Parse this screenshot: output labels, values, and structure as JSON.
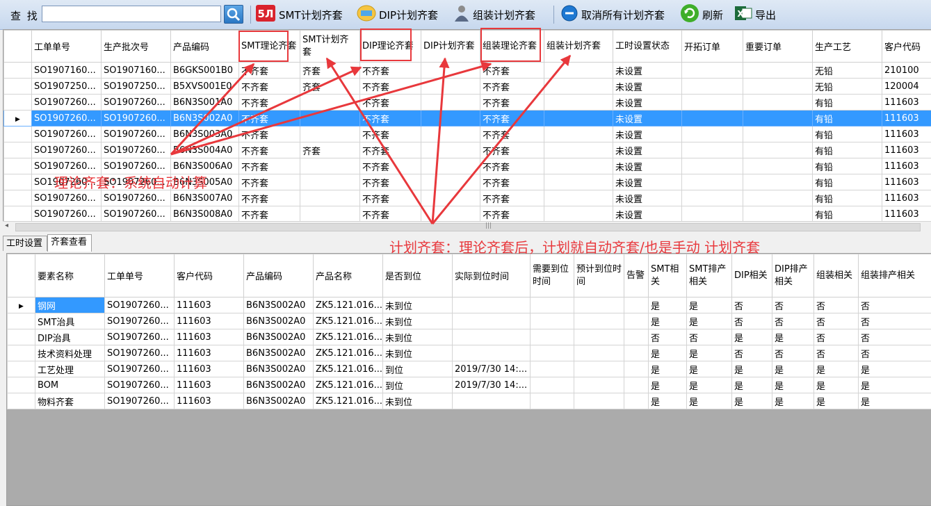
{
  "toolbar": {
    "search_label": "查 找",
    "search_value": "",
    "buttons": [
      {
        "label": "SMT计划齐套",
        "icon": "smt-icon"
      },
      {
        "label": "DIP计划齐套",
        "icon": "dip-icon"
      },
      {
        "label": "组装计划齐套",
        "icon": "person-icon"
      },
      {
        "label": "取消所有计划齐套",
        "icon": "cancel-icon"
      },
      {
        "label": "刷新",
        "icon": "refresh-icon"
      },
      {
        "label": "导出",
        "icon": "excel-icon"
      }
    ]
  },
  "top_grid": {
    "columns": [
      "工单单号",
      "生产批次号",
      "产品编码",
      "SMT理论齐套",
      "SMT计划齐套",
      "DIP理论齐套",
      "DIP计划齐套",
      "组装理论齐套",
      "组装计划齐套",
      "工时设置状态",
      "开拓订单",
      "重要订单",
      "生产工艺",
      "客户代码"
    ],
    "rows": [
      [
        "SO1907160...",
        "SO1907160...",
        "B6GKS001B0",
        "不齐套",
        "齐套",
        "不齐套",
        "",
        "不齐套",
        "",
        "未设置",
        "",
        "",
        "无铅",
        "210100"
      ],
      [
        "SO1907250...",
        "SO1907250...",
        "B5XVS001E0",
        "不齐套",
        "齐套",
        "不齐套",
        "",
        "不齐套",
        "",
        "未设置",
        "",
        "",
        "无铅",
        "120004"
      ],
      [
        "SO1907260...",
        "SO1907260...",
        "B6N3S001A0",
        "不齐套",
        "",
        "不齐套",
        "",
        "不齐套",
        "",
        "未设置",
        "",
        "",
        "有铅",
        "111603"
      ],
      [
        "SO1907260...",
        "SO1907260...",
        "B6N3S002A0",
        "不齐套",
        "",
        "不齐套",
        "",
        "不齐套",
        "",
        "未设置",
        "",
        "",
        "有铅",
        "111603"
      ],
      [
        "SO1907260...",
        "SO1907260...",
        "B6N3S003A0",
        "不齐套",
        "",
        "不齐套",
        "",
        "不齐套",
        "",
        "未设置",
        "",
        "",
        "有铅",
        "111603"
      ],
      [
        "SO1907260...",
        "SO1907260...",
        "B6N3S004A0",
        "不齐套",
        "齐套",
        "不齐套",
        "",
        "不齐套",
        "",
        "未设置",
        "",
        "",
        "有铅",
        "111603"
      ],
      [
        "SO1907260...",
        "SO1907260...",
        "B6N3S006A0",
        "不齐套",
        "",
        "不齐套",
        "",
        "不齐套",
        "",
        "未设置",
        "",
        "",
        "有铅",
        "111603"
      ],
      [
        "SO1907260...",
        "SO1907260...",
        "B6N3S005A0",
        "不齐套",
        "",
        "不齐套",
        "",
        "不齐套",
        "",
        "未设置",
        "",
        "",
        "有铅",
        "111603"
      ],
      [
        "SO1907260...",
        "SO1907260...",
        "B6N3S007A0",
        "不齐套",
        "",
        "不齐套",
        "",
        "不齐套",
        "",
        "未设置",
        "",
        "",
        "有铅",
        "111603"
      ],
      [
        "SO1907260...",
        "SO1907260...",
        "B6N3S008A0",
        "不齐套",
        "",
        "不齐套",
        "",
        "不齐套",
        "",
        "未设置",
        "",
        "",
        "有铅",
        "111603"
      ]
    ],
    "selected_row": 3
  },
  "tabs": [
    {
      "label": "工时设置",
      "active": false
    },
    {
      "label": "齐套查看",
      "active": true
    }
  ],
  "bottom_grid": {
    "columns": [
      "要素名称",
      "工单单号",
      "客户代码",
      "产品编码",
      "产品名称",
      "是否到位",
      "实际到位时间",
      "需要到位时间",
      "预计到位时间",
      "告警",
      "SMT相关",
      "SMT排产相关",
      "DIP相关",
      "DIP排产相关",
      "组装相关",
      "组装排产相关"
    ],
    "rows": [
      [
        "钢网",
        "SO1907260...",
        "111603",
        "B6N3S002A0",
        "ZK5.121.016...",
        "未到位",
        "",
        "",
        "",
        "",
        "是",
        "是",
        "否",
        "否",
        "否",
        "否"
      ],
      [
        "SMT治具",
        "SO1907260...",
        "111603",
        "B6N3S002A0",
        "ZK5.121.016...",
        "未到位",
        "",
        "",
        "",
        "",
        "是",
        "是",
        "否",
        "否",
        "否",
        "否"
      ],
      [
        "DIP治具",
        "SO1907260...",
        "111603",
        "B6N3S002A0",
        "ZK5.121.016...",
        "未到位",
        "",
        "",
        "",
        "",
        "否",
        "否",
        "是",
        "是",
        "否",
        "否"
      ],
      [
        "技术资料处理",
        "SO1907260...",
        "111603",
        "B6N3S002A0",
        "ZK5.121.016...",
        "未到位",
        "",
        "",
        "",
        "",
        "是",
        "是",
        "否",
        "否",
        "否",
        "否"
      ],
      [
        "工艺处理",
        "SO1907260...",
        "111603",
        "B6N3S002A0",
        "ZK5.121.016...",
        "到位",
        "2019/7/30 14:...",
        "",
        "",
        "",
        "是",
        "是",
        "是",
        "是",
        "是",
        "是"
      ],
      [
        "BOM",
        "SO1907260...",
        "111603",
        "B6N3S002A0",
        "ZK5.121.016...",
        "到位",
        "2019/7/30 14:...",
        "",
        "",
        "",
        "是",
        "是",
        "是",
        "是",
        "是",
        "是"
      ],
      [
        "物料齐套",
        "SO1907260...",
        "111603",
        "B6N3S002A0",
        "ZK5.121.016...",
        "未到位",
        "",
        "",
        "",
        "",
        "是",
        "是",
        "是",
        "是",
        "是",
        "是"
      ]
    ],
    "selected_row": 0
  },
  "annotations": {
    "theory_text": "理论齐套：系统自动计算",
    "plan_text": "计划齐套：理论齐套后，计划就自动齐套/也是手动 计划齐套",
    "color": "#e8383c"
  }
}
